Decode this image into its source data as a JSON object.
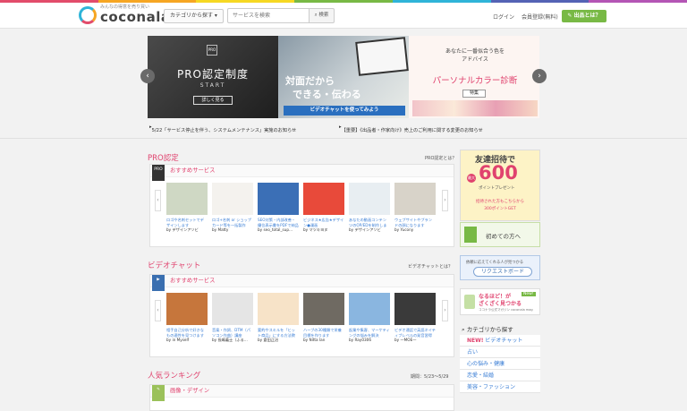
{
  "colors": {
    "stripe": [
      "#e24c6b",
      "#f6a623",
      "#f6d823",
      "#78b945",
      "#2fb4d8",
      "#5463b5",
      "#b455b5"
    ],
    "accent": "#e0426e",
    "link": "#3a7ed5",
    "green": "#78b945"
  },
  "header": {
    "logo_tag": "みんなの得意を売り買い",
    "logo_name": "coconala",
    "category_btn": "カテゴリから探す ▾",
    "search_placeholder": "サービスを検索",
    "search_btn": "検索",
    "login": "ログイン",
    "register": "会員登録(無料)",
    "post_btn": "出品とは？"
  },
  "banners": [
    {
      "badge": "PRO",
      "title": "PRO認定制度",
      "sub": "START",
      "btn": "詳しく見る"
    },
    {
      "title": "対面だから",
      "title2": "できる・伝わる",
      "btn": "ビデオチャットを使ってみよう"
    },
    {
      "lead": "あなたに一番似合う色を",
      "lead2": "アドバイス",
      "title": "パーソナルカラー診断",
      "badge": "特集"
    }
  ],
  "notices": [
    "5/22「サービス停止を伴う、システムメンテナンス」実施のお知らせ",
    "【重要】《出品者・作家向け》売上のご利用に関する変更のお知らせ"
  ],
  "pro": {
    "title": "PRO認定",
    "link": "PRO認定とは？",
    "head": "おすすめサービス",
    "badge": "PRO",
    "items": [
      {
        "text": "ロゴや名刺セットでデザインします",
        "by": "by デザインアソビ",
        "color": "#cfd8c4"
      },
      {
        "text": "ロゴ+名刺 or ショップカード等を一括製作",
        "by": "by Matty",
        "color": "#f4f2ee"
      },
      {
        "text": "SEO対策・内部改善・優位表示書をPDFで納品",
        "by": "by seo_total_sup...",
        "color": "#3b6fb6"
      },
      {
        "text": "ビジネス★広告★デザイン●漫画",
        "by": "by マツキヨヌ",
        "color": "#e84a3a"
      },
      {
        "text": "あなたの動画コンテンツのOP/EDを制作します",
        "by": "by デザインアソビ",
        "color": "#e8eef2"
      },
      {
        "text": "ウェブサイトやブランドの顔になります",
        "by": "by Yucony",
        "color": "#d8d3c9"
      }
    ]
  },
  "video": {
    "title": "ビデオチャット",
    "link": "ビデオチャットとは？",
    "head": "おすすめサービス",
    "items": [
      {
        "text": "相手自己分析で好きなもの適性を見つけます",
        "by": "by in Myself",
        "color": "#c6763c"
      },
      {
        "text": "音楽・作詞、DTM（パソコン作曲）講座",
        "by": "by 長嶋義士（ふる...",
        "color": "#e5e5e5"
      },
      {
        "text": "要約やスキルを「ヒット商品」にする方法教えます",
        "by": "by 倉田正治",
        "color": "#f7e3c8"
      },
      {
        "text": "ハーブの30種類で栄養目標を作ります",
        "by": "by Nitta Ian",
        "color": "#6f6a62"
      },
      {
        "text": "起業や集客、マーケティングの悩みを解決",
        "by": "by Ray0306",
        "color": "#8ab6e0"
      },
      {
        "text": "ビデオ通話で英語ネイティブレベルの発音習得",
        "by": "by 一MOE一",
        "color": "#3a3a3a"
      }
    ]
  },
  "ranking": {
    "title": "人気ランキング",
    "period": "期間：5/23〜5/29",
    "head": "画像・デザイン"
  },
  "side": {
    "invite_title": "友達招待で",
    "invite_num": "600",
    "invite_sub": "ポイントプレゼント",
    "invite_label": "最大",
    "invite_note": "招待された方もこちらから",
    "invite_note2": "300ポイントGET",
    "beginner": "初めての方へ",
    "request_top": "依頼に応えてくれる人が見つかる",
    "request": "リクエストボード",
    "naruhodo": "なるほど！が",
    "naruhodo2": "ざくざく見つかる",
    "naruhodo_tag": "New!",
    "naruhodo_sub": "ココナラ公式マガジン coconala mag",
    "cat_head": "カテゴリから探す",
    "cats": [
      {
        "label": "ビデオチャット",
        "new": "NEW!"
      },
      {
        "label": "占い"
      },
      {
        "label": "心の悩み・健康"
      },
      {
        "label": "恋愛・結婚"
      },
      {
        "label": "美容・ファッション"
      }
    ]
  }
}
